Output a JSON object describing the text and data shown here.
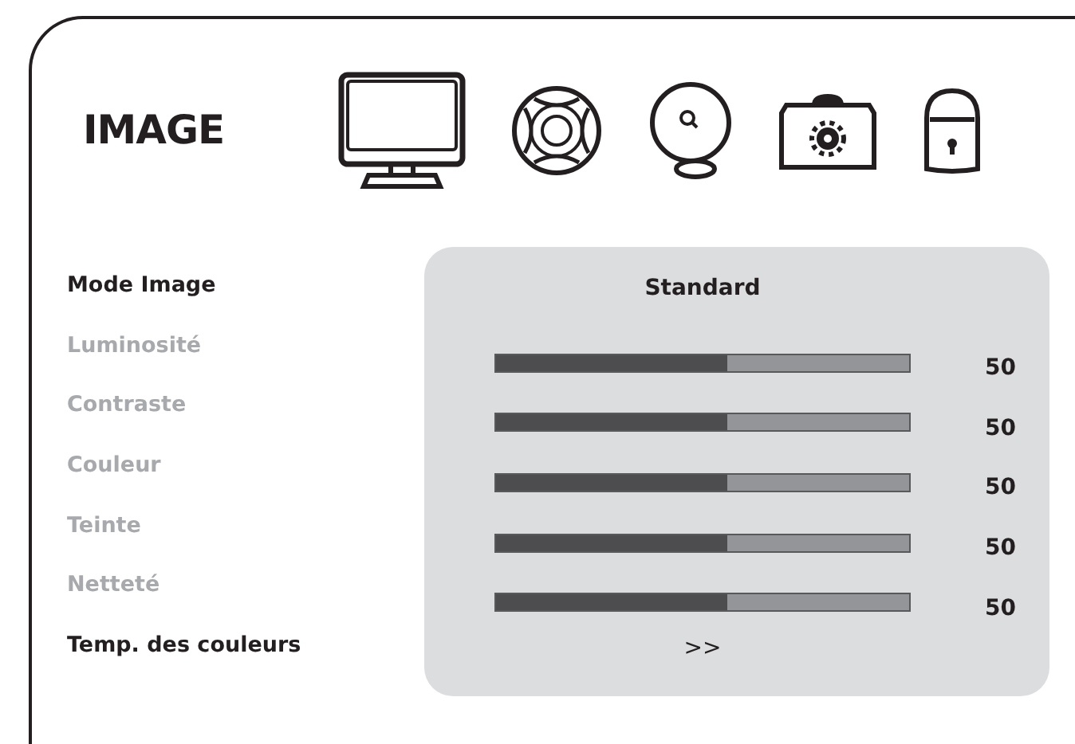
{
  "title": "IMAGE",
  "rows": [
    {
      "kind": "value",
      "label": "Mode Image",
      "disabled": false,
      "value": "Standard"
    },
    {
      "kind": "slider",
      "label": "Luminosité",
      "disabled": true,
      "level": 0.56,
      "reading": "50"
    },
    {
      "kind": "slider",
      "label": "Contraste",
      "disabled": true,
      "level": 0.56,
      "reading": "50"
    },
    {
      "kind": "slider",
      "label": "Couleur",
      "disabled": true,
      "level": 0.56,
      "reading": "50"
    },
    {
      "kind": "slider",
      "label": "Teinte",
      "disabled": true,
      "level": 0.56,
      "reading": "50"
    },
    {
      "kind": "slider",
      "label": "Netteté",
      "disabled": true,
      "level": 0.56,
      "reading": "50"
    },
    {
      "kind": "value",
      "label": "Temp. des couleurs",
      "disabled": false,
      "value": ">>"
    }
  ]
}
